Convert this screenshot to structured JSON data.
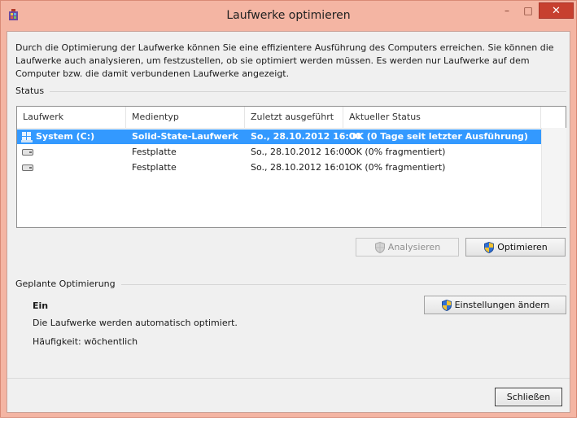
{
  "window": {
    "title": "Laufwerke optimieren",
    "minimize": "–",
    "maximize": "□",
    "close": "✕"
  },
  "description": "Durch die Optimierung der Laufwerke können Sie eine effizientere Ausführung des Computers erreichen. Sie können die Laufwerke auch analysieren, um festzustellen, ob sie optimiert werden müssen. Es werden nur Laufwerke auf dem Computer bzw. die damit verbundenen Laufwerke angezeigt.",
  "status": {
    "label": "Status",
    "columns": [
      "Laufwerk",
      "Medientyp",
      "Zuletzt ausgeführt",
      "Aktueller Status"
    ],
    "rows": [
      {
        "drive": "System (C:)",
        "media": "Solid-State-Laufwerk",
        "last": "So., 28.10.2012 16:00",
        "state": "OK (0 Tage seit letzter Ausführung)",
        "selected": true,
        "icon": "windows-drive-icon"
      },
      {
        "drive": "",
        "media": "Festplatte",
        "last": "So., 28.10.2012 16:00",
        "state": "OK (0% fragmentiert)",
        "selected": false,
        "icon": "hard-drive-icon"
      },
      {
        "drive": "",
        "media": "Festplatte",
        "last": "So., 28.10.2012 16:01",
        "state": "OK (0% fragmentiert)",
        "selected": false,
        "icon": "hard-drive-icon"
      }
    ],
    "analyze_label": "Analysieren",
    "optimize_label": "Optimieren"
  },
  "schedule": {
    "label": "Geplante Optimierung",
    "state": "Ein",
    "info": "Die Laufwerke werden automatisch optimiert.",
    "frequency": "Häufigkeit: wöchentlich",
    "change_label": "Einstellungen ändern"
  },
  "close_label": "Schließen",
  "colors": {
    "frame": "#f4b5a3",
    "selection": "#3399ff",
    "close_button": "#c7402f"
  }
}
